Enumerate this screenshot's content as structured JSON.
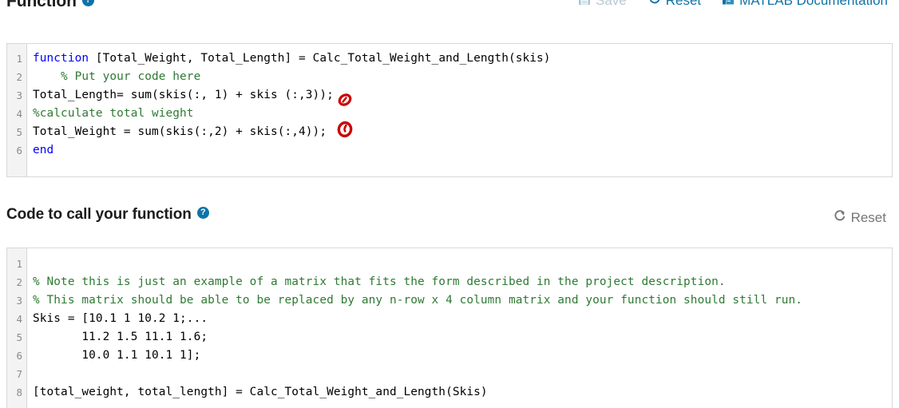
{
  "function_section": {
    "title": "Function",
    "help_icon": "help-circle-icon",
    "toolbar": {
      "save_label": "Save",
      "save_icon": "floppy-disk-icon",
      "reset_label": "Reset",
      "reset_icon": "refresh-icon",
      "docs_label": "MATLAB Documentation",
      "docs_icon": "book-icon"
    },
    "editor": {
      "lines": [
        {
          "n": "1",
          "segments": [
            {
              "text": "function",
              "cls": "kw"
            },
            {
              "text": " [Total_Weight, Total_Length] = Calc_Total_Weight_and_Length(skis)",
              "cls": ""
            }
          ]
        },
        {
          "n": "2",
          "segments": [
            {
              "text": "    % Put your code here",
              "cls": "cm"
            }
          ]
        },
        {
          "n": "3",
          "segments": [
            {
              "text": "Total_Length= sum(skis(:, 1) + skis (:,3));",
              "cls": ""
            }
          ]
        },
        {
          "n": "4",
          "segments": [
            {
              "text": "%calculate total wieght",
              "cls": "cm"
            }
          ]
        },
        {
          "n": "5",
          "segments": [
            {
              "text": "Total_Weight = sum(skis(:,2) + skis(:,4));",
              "cls": ""
            }
          ]
        },
        {
          "n": "6",
          "segments": [
            {
              "text": "end",
              "cls": "kw"
            }
          ]
        }
      ]
    },
    "annotations": [
      {
        "name": "red-circle-annotation-line3",
        "color": "#cc0000"
      },
      {
        "name": "red-circle-annotation-line5",
        "color": "#cc0000"
      }
    ]
  },
  "call_section": {
    "title": "Code to call your function",
    "help_icon": "help-circle-icon",
    "toolbar": {
      "reset_label": "Reset",
      "reset_icon": "refresh-icon"
    },
    "editor": {
      "lines": [
        {
          "n": "1",
          "segments": [
            {
              "text": "",
              "cls": ""
            }
          ]
        },
        {
          "n": "2",
          "segments": [
            {
              "text": "% Note this is just an example of a matrix that fits the form described in the project description.",
              "cls": "cm"
            }
          ]
        },
        {
          "n": "3",
          "segments": [
            {
              "text": "% This matrix should be able to be replaced by any n-row x 4 column matrix and your function should still run.",
              "cls": "cm"
            }
          ]
        },
        {
          "n": "4",
          "segments": [
            {
              "text": "Skis = [10.1 1 10.2 1;...",
              "cls": ""
            }
          ]
        },
        {
          "n": "5",
          "segments": [
            {
              "text": "       11.2 1.5 11.1 1.6;",
              "cls": ""
            }
          ]
        },
        {
          "n": "6",
          "segments": [
            {
              "text": "       10.0 1.1 10.1 1];",
              "cls": ""
            }
          ]
        },
        {
          "n": "7",
          "segments": [
            {
              "text": "",
              "cls": ""
            }
          ]
        },
        {
          "n": "8",
          "segments": [
            {
              "text": "[total_weight, total_length] = Calc_Total_Weight_and_Length(Skis)",
              "cls": ""
            }
          ]
        }
      ]
    }
  },
  "colors": {
    "accent_teal": "#0f73a8",
    "keyword_blue": "#0000ff",
    "comment_green": "#2e7a33",
    "annotation_red": "#cc0000",
    "muted_gray": "#767676"
  }
}
